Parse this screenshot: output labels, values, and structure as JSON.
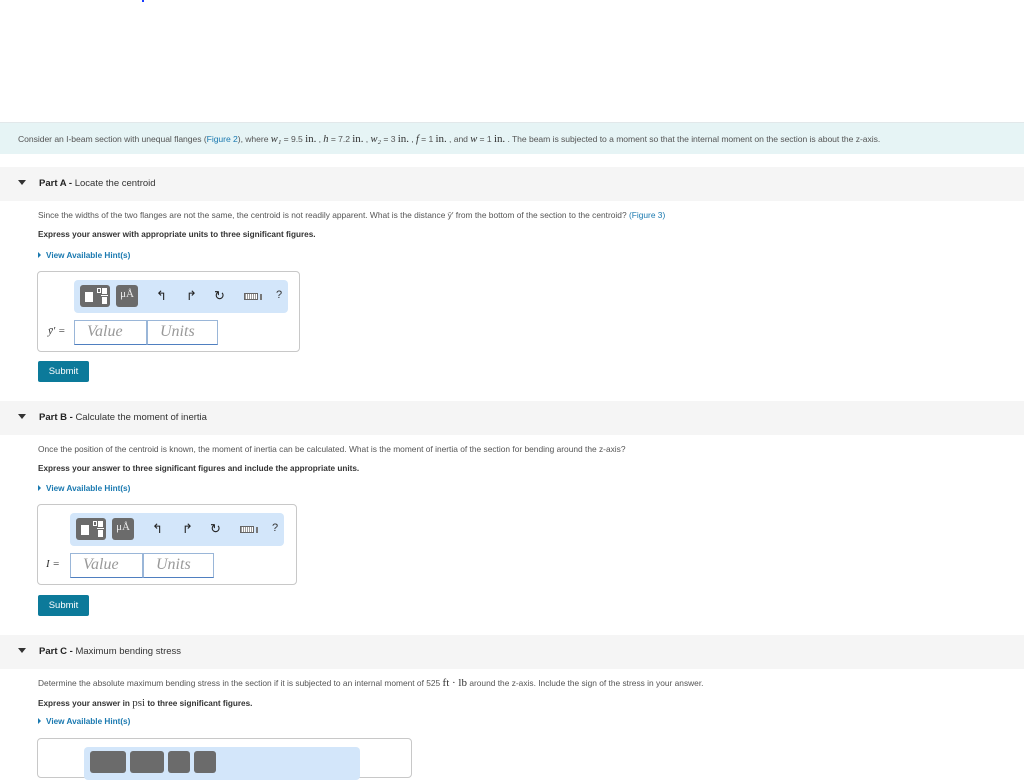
{
  "intro": {
    "prefix": "Consider an I-beam section with unequal flanges (",
    "figure_link": "Figure 2",
    "mid": "), where ",
    "w1_var": "w₁",
    "w1_value": "9.5",
    "h_var": "h",
    "h_value": "7.2",
    "w2_var": "w₂",
    "w2_value": "3",
    "f_var": "f",
    "f_value": "1",
    "w_var": "w",
    "w_value": "1",
    "unit": "in.",
    "suffix": "The beam is subjected to a moment so that the internal moment on the section is about the z-axis."
  },
  "parts": [
    {
      "label": "Part A",
      "title": "Locate the centroid",
      "question": "Since the widths of the two flanges are not the same, the centroid is not readily apparent. What is the distance ȳ′ from the bottom of the section to the centroid?",
      "figure_link": "(Figure 3)",
      "instruction": "Express your answer with appropriate units to three significant figures.",
      "hint_label": "View Available Hint(s)",
      "variable": "ȳ′ =",
      "value_placeholder": "Value",
      "units_placeholder": "Units",
      "submit_label": "Submit"
    },
    {
      "label": "Part B",
      "title": "Calculate the moment of inertia",
      "question": "Once the position of the centroid is known, the moment of inertia can be calculated. What is the moment of inertia of the section for bending around the z-axis?",
      "instruction": "Express your answer to three significant figures and include the appropriate units.",
      "hint_label": "View Available Hint(s)",
      "variable": "I =",
      "value_placeholder": "Value",
      "units_placeholder": "Units",
      "submit_label": "Submit"
    },
    {
      "label": "Part C",
      "title": "Maximum bending stress",
      "question_prefix": "Determine the absolute maximum bending stress in the section if it is subjected to an internal moment of 525 ",
      "moment_unit": "ft · lb",
      "question_suffix": " around the z-axis. Include the sign of the stress in your answer.",
      "instruction_prefix": "Express your answer in ",
      "instruction_unit": "psi",
      "instruction_suffix": " to three significant figures.",
      "hint_label": "View Available Hint(s)"
    }
  ],
  "toolbar": {
    "templates_icon": "fraction-template-icon",
    "units_label": "μÅ",
    "undo_icon": "↰",
    "redo_icon": "↱",
    "reset_icon": "↻",
    "keyboard_icon": "keyboard-icon",
    "help_label": "?"
  }
}
